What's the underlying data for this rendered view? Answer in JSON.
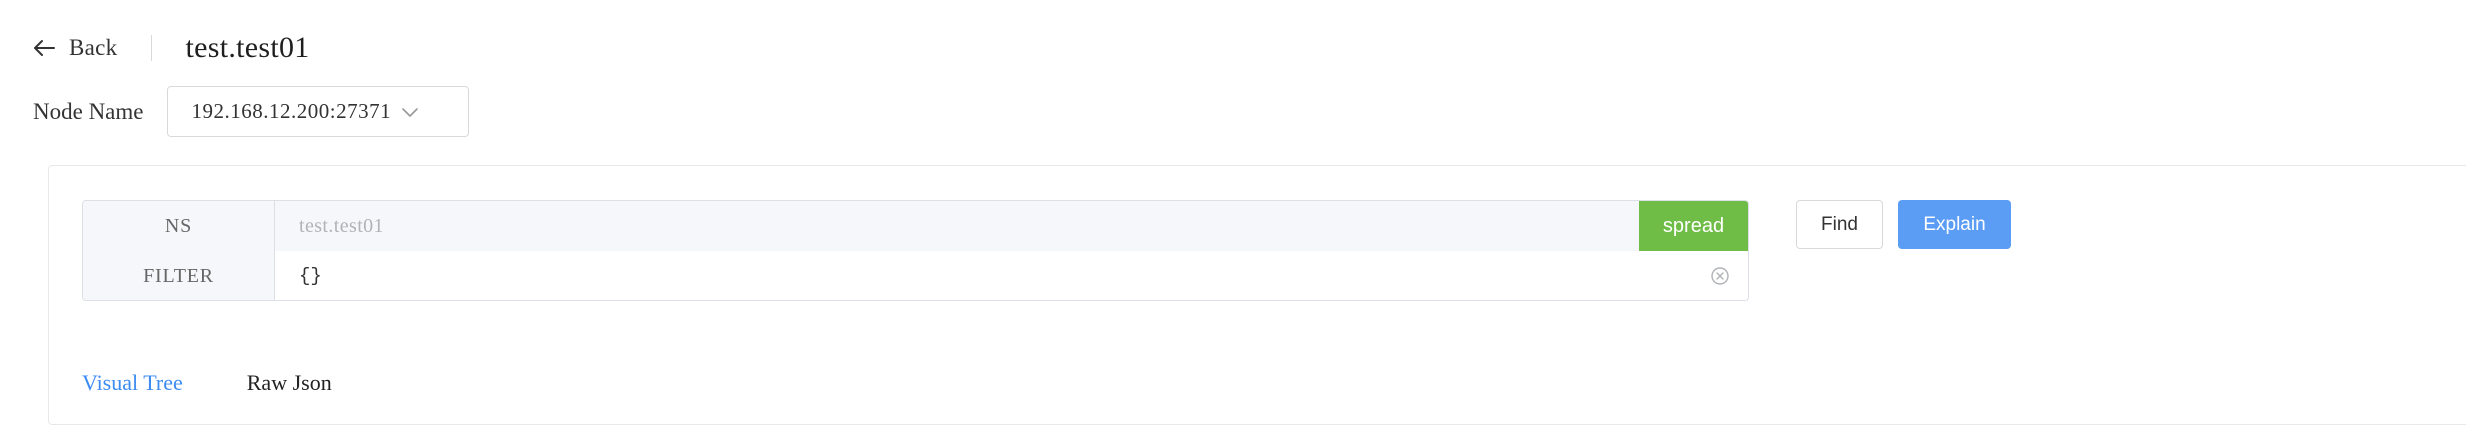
{
  "header": {
    "back_label": "Back",
    "title": "test.test01"
  },
  "node": {
    "label": "Node Name",
    "selected": "192.168.12.200:27371"
  },
  "query": {
    "ns_label": "NS",
    "ns_value": "test.test01",
    "spread_label": "spread",
    "filter_label": "FILTER",
    "filter_value": "{}"
  },
  "actions": {
    "find_label": "Find",
    "explain_label": "Explain"
  },
  "tabs": [
    {
      "label": "Visual Tree",
      "active": true
    },
    {
      "label": "Raw Json",
      "active": false
    }
  ],
  "colors": {
    "accent": "#3c8bf1",
    "primary_button": "#5b9cf4",
    "spread_button": "#6fbd46"
  },
  "icons": {
    "back": "arrow-left-icon",
    "select": "chevron-down-icon",
    "clear": "clear-circle-icon"
  }
}
